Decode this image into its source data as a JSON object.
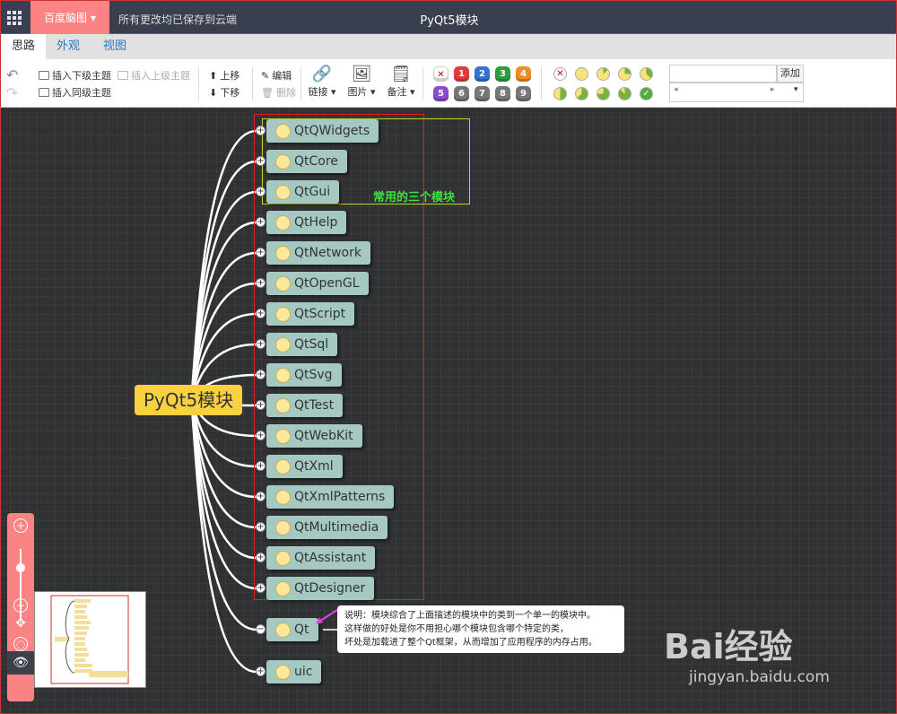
{
  "topbar": {
    "menu_icon": "grid-icon",
    "brand": "百度脑图",
    "save_status": "所有更改均已保存到云端",
    "doc_title": "PyQt5模块"
  },
  "tabs": [
    "思路",
    "外观",
    "视图"
  ],
  "toolbar": {
    "insert_child": "插入下级主题",
    "insert_parent": "插入上级主题",
    "insert_sibling": "插入同级主题",
    "move_up": "上移",
    "move_down": "下移",
    "edit": "编辑",
    "delete": "删除",
    "link": "链接",
    "image": "图片",
    "note": "备注",
    "priorities": [
      "1",
      "2",
      "3",
      "4",
      "5",
      "6",
      "7",
      "8",
      "9"
    ],
    "resource_add": "添加"
  },
  "mindmap": {
    "root": "PyQt5模块",
    "children": [
      "QtQWidgets",
      "QtCore",
      "QtGui",
      "QtHelp",
      "QtNetwork",
      "QtOpenGL",
      "QtScript",
      "QtSql",
      "QtSvg",
      "QtTest",
      "QtWebKit",
      "QtXml",
      "QtXmlPatterns",
      "QtMultimedia",
      "QtAssistant",
      "QtDesigner",
      "Qt",
      "uic"
    ],
    "annotation": "常用的三个模块",
    "note_lines": [
      "说明：模块综合了上面描述的模块中的类到一个单一的模块中。",
      "这样做的好处是你不用担心哪个模块包含哪个特定的类，",
      "坏处是加载进了整个Qt框架，从而增加了应用程序的内存占用。"
    ]
  },
  "watermark": {
    "logo": "Bai经验",
    "url": "jingyan.baidu.com"
  },
  "colors": {
    "brand": "#fc8383",
    "topbar": "#393f4f",
    "node": "#a5c8c3",
    "root": "#f9d03f",
    "canvas": "#2f3133"
  }
}
